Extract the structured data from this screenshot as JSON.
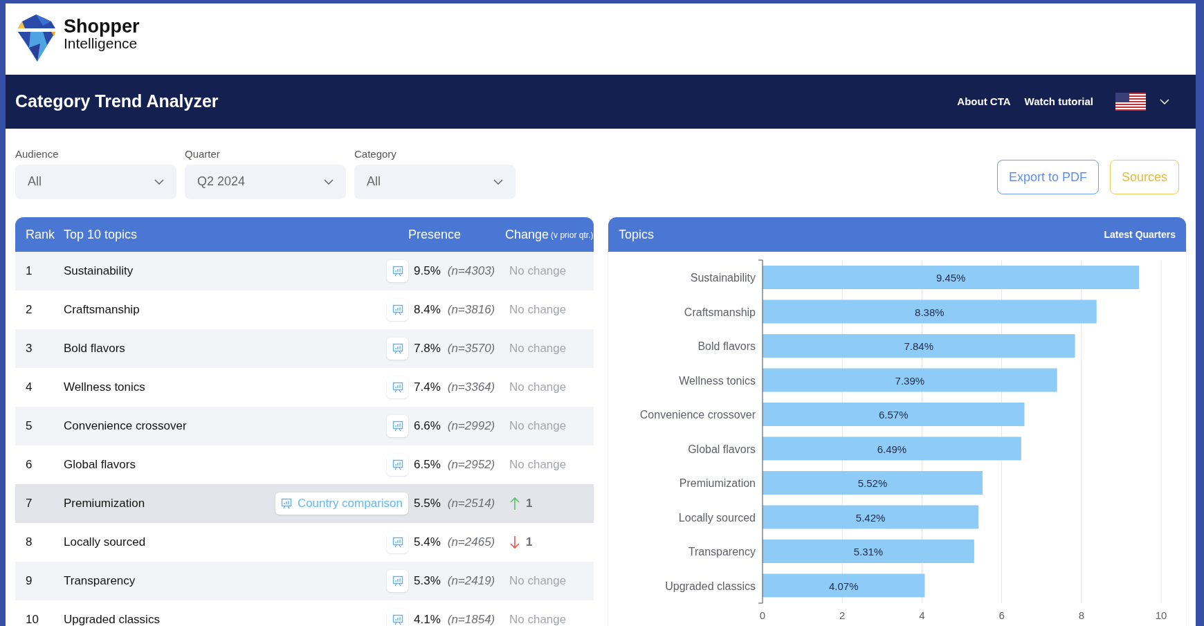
{
  "brand": {
    "line_1": "Shopper",
    "line_2": "Intelligence"
  },
  "nav": {
    "title": "Category Trend Analyzer",
    "links": [
      "About CTA",
      "Watch tutorial"
    ]
  },
  "filters": [
    {
      "label": "Audience",
      "value": "All"
    },
    {
      "label": "Quarter",
      "value": "Q2 2024"
    },
    {
      "label": "Category",
      "value": "All"
    }
  ],
  "actions": [
    {
      "kind": "primary",
      "label": "Export to PDF"
    },
    {
      "kind": "secondary",
      "label": "Sources"
    }
  ],
  "table": {
    "columns": {
      "rank": "Rank",
      "topic": "Top 10 topics",
      "presence": "Presence",
      "change": "Change",
      "change_note": "(v prior qtr.)"
    },
    "rows": [
      {
        "rank": "1",
        "topic": "Sustainability",
        "presence": "9.5%",
        "n": "(n=4303)",
        "change": {
          "kind": "none",
          "text": "No change"
        },
        "hovered": false
      },
      {
        "rank": "2",
        "topic": "Craftsmanship",
        "presence": "8.4%",
        "n": "(n=3816)",
        "change": {
          "kind": "none",
          "text": "No change"
        },
        "hovered": false
      },
      {
        "rank": "3",
        "topic": "Bold flavors",
        "presence": "7.8%",
        "n": "(n=3570)",
        "change": {
          "kind": "none",
          "text": "No change"
        },
        "hovered": false
      },
      {
        "rank": "4",
        "topic": "Wellness tonics",
        "presence": "7.4%",
        "n": "(n=3364)",
        "change": {
          "kind": "none",
          "text": "No change"
        },
        "hovered": false
      },
      {
        "rank": "5",
        "topic": "Convenience crossover",
        "presence": "6.6%",
        "n": "(n=2992)",
        "change": {
          "kind": "none",
          "text": "No change"
        },
        "hovered": false
      },
      {
        "rank": "6",
        "topic": "Global flavors",
        "presence": "6.5%",
        "n": "(n=2952)",
        "change": {
          "kind": "none",
          "text": "No change"
        },
        "hovered": false
      },
      {
        "rank": "7",
        "topic": "Premiumization",
        "presence": "5.5%",
        "n": "(n=2514)",
        "change": {
          "kind": "up",
          "text": "1"
        },
        "hovered": true,
        "compare_label": "Country comparison"
      },
      {
        "rank": "8",
        "topic": "Locally sourced",
        "presence": "5.4%",
        "n": "(n=2465)",
        "change": {
          "kind": "down",
          "text": "1"
        },
        "hovered": false
      },
      {
        "rank": "9",
        "topic": "Transparency",
        "presence": "5.3%",
        "n": "(n=2419)",
        "change": {
          "kind": "none",
          "text": "No change"
        },
        "hovered": false
      },
      {
        "rank": "10",
        "topic": "Upgraded classics",
        "presence": "4.1%",
        "n": "(n=1854)",
        "change": {
          "kind": "none",
          "text": "No change"
        },
        "hovered": false
      }
    ]
  },
  "chart_panel": {
    "title": "Topics",
    "link": "Latest Quarters",
    "chart_data": {
      "type": "bar",
      "orientation": "horizontal",
      "categories": [
        "Sustainability",
        "Craftsmanship",
        "Bold flavors",
        "Wellness tonics",
        "Convenience crossover",
        "Global flavors",
        "Premiumization",
        "Locally sourced",
        "Transparency",
        "Upgraded classics"
      ],
      "grid": true,
      "series": [
        {
          "color": "#8ecbf6",
          "values": [
            9.45,
            8.38,
            7.84,
            7.39,
            6.57,
            6.49,
            5.52,
            5.42,
            5.31,
            4.07
          ]
        }
      ],
      "value_labels": [
        "9.45%",
        "8.38%",
        "7.84%",
        "7.39%",
        "6.57%",
        "6.49%",
        "5.52%",
        "5.42%",
        "5.31%",
        "4.07%"
      ],
      "xlim": [
        0,
        10
      ],
      "xticks": [
        0,
        2,
        4,
        6,
        8,
        10
      ]
    }
  }
}
